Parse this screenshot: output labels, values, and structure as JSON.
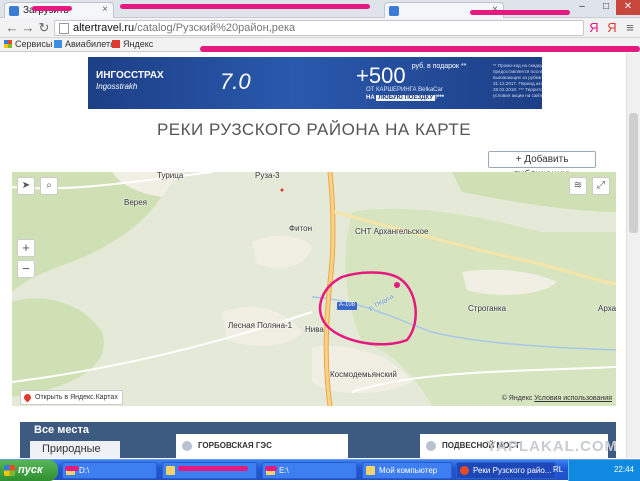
{
  "browser": {
    "tabs": [
      {
        "label": "Загрузить"
      },
      {
        "label": ""
      }
    ],
    "address": {
      "domain": "altertravel.ru",
      "path": "/catalog/Рузский%20район,река"
    },
    "bookmarks": [
      "Сервисы",
      "Авиабилеты",
      "Яндекс"
    ]
  },
  "banner": {
    "logo": "ИНГОССТРАХ",
    "logo_sub": "Ingosstrakh",
    "seven": "7.0",
    "offer": "+500",
    "offer_small": "руб. в подарок **",
    "line2": "ОТ КАРШЕРИНГА BelkaCar",
    "line3_prefix": "НА ",
    "line3_highlight": "ЛЮБУЮ ПОЕЗДКУ",
    "line3_suffix": "!***",
    "fine": "** Промо-код на скидку 500 руб. от каршеринга BelkaCar предоставляется после заключения Договора страхования рисков выезжающих за рубеж на сайте ingos.ru, в период с 24.11.2017 по 31.12.2017. Период активации промо-кода с 24.11.2017 по 28.02.2018. *** Территория Москвы и Московской обл. Подробные условия акции на сайте ingos.ru."
  },
  "page": {
    "heading": "РЕКИ РУЗСКОГО РАЙОНА НА КАРТЕ",
    "add_button": "+ Добавить публикацию"
  },
  "map": {
    "labels": {
      "turitsa": "Турица",
      "ruza": "Руза-3",
      "vereya": "Верея",
      "fiton": "Фитон",
      "snt": "СНТ Архангельское",
      "road": "А-108",
      "river": "р. Педуса",
      "stroganka": "Строганка",
      "arkh": "Архан",
      "lesnaya": "Лесная Поляна-1",
      "niva": "Нива",
      "kosmo": "Космодемьянский"
    },
    "zoom_in": "+",
    "zoom_out": "−",
    "open_yandex": "Открыть в Яндекс.Картах",
    "copyright": "© Яндекс",
    "terms": "Условия использования"
  },
  "places": {
    "title": "Все места",
    "chip": "Природные",
    "cards": [
      "ГОРБОВСКАЯ ГЭС",
      "ПОДВЕСНОЙ МОСТ"
    ]
  },
  "watermark": "YAPLAKAL.COM",
  "taskbar": {
    "start": "пуск",
    "buttons": [
      "D:\\",
      "",
      "E:\\",
      "Мой компьютер",
      "Реки Рузского райо..."
    ],
    "lang": "RL",
    "clock": "22:44"
  },
  "colors": {
    "annotation": "#e5197f",
    "banner": "#1d3f86",
    "taskbar": "#2158d4"
  }
}
